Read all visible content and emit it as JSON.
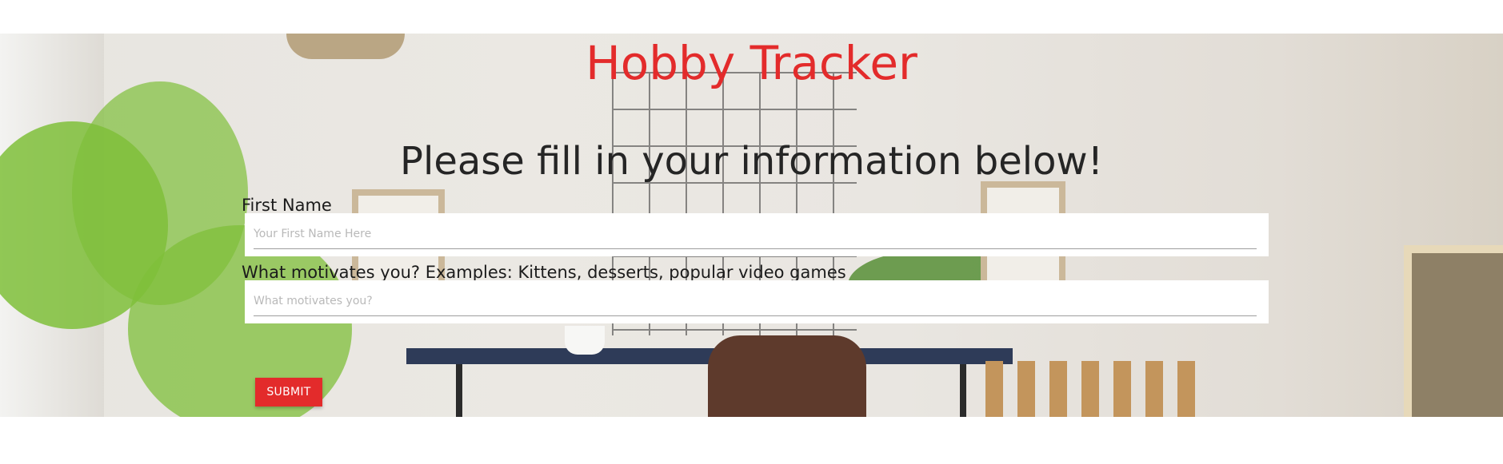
{
  "page": {
    "title": "Hobby Tracker",
    "subtitle": "Please fill in your information below!"
  },
  "form": {
    "first_name": {
      "label": "First Name",
      "placeholder": "Your First Name Here",
      "value": ""
    },
    "motivation": {
      "label": "What motivates you? Examples: Kittens, desserts, popular video games",
      "placeholder": "What motivates you?",
      "value": ""
    },
    "submit_label": "SUBMIT"
  },
  "colors": {
    "accent": "#e32b2b",
    "text": "#252525",
    "field_background": "#ffffff"
  },
  "background_image": "home-office-desk-scene"
}
